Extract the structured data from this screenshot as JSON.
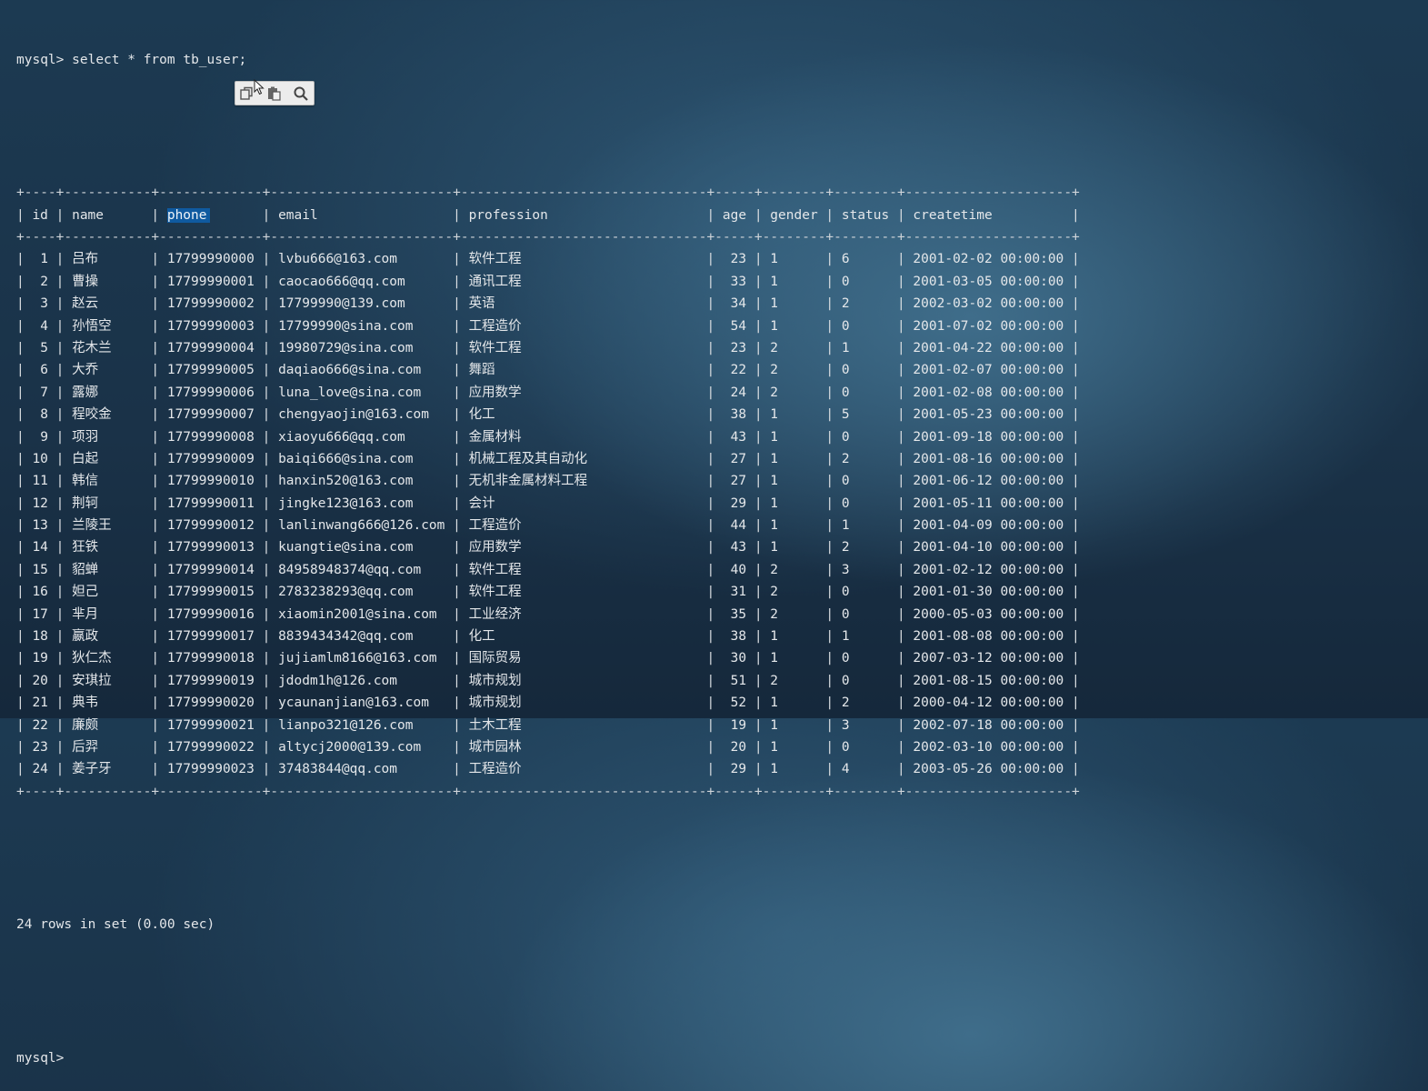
{
  "terminal": {
    "prompt": "mysql>",
    "command": "select * from tb_user;",
    "footer": "24 rows in set (0.00 sec)",
    "final_prompt": "mysql>"
  },
  "table": {
    "columns": [
      "id",
      "name",
      "phone",
      "email",
      "profession",
      "age",
      "gender",
      "status",
      "createtime"
    ],
    "highlighted_column": "phone",
    "rows": [
      [
        "1",
        "吕布",
        "17799990000",
        "lvbu666@163.com",
        "软件工程",
        "23",
        "1",
        "6",
        "2001-02-02 00:00:00"
      ],
      [
        "2",
        "曹操",
        "17799990001",
        "caocao666@qq.com",
        "通讯工程",
        "33",
        "1",
        "0",
        "2001-03-05 00:00:00"
      ],
      [
        "3",
        "赵云",
        "17799990002",
        "17799990@139.com",
        "英语",
        "34",
        "1",
        "2",
        "2002-03-02 00:00:00"
      ],
      [
        "4",
        "孙悟空",
        "17799990003",
        "17799990@sina.com",
        "工程造价",
        "54",
        "1",
        "0",
        "2001-07-02 00:00:00"
      ],
      [
        "5",
        "花木兰",
        "17799990004",
        "19980729@sina.com",
        "软件工程",
        "23",
        "2",
        "1",
        "2001-04-22 00:00:00"
      ],
      [
        "6",
        "大乔",
        "17799990005",
        "daqiao666@sina.com",
        "舞蹈",
        "22",
        "2",
        "0",
        "2001-02-07 00:00:00"
      ],
      [
        "7",
        "露娜",
        "17799990006",
        "luna_love@sina.com",
        "应用数学",
        "24",
        "2",
        "0",
        "2001-02-08 00:00:00"
      ],
      [
        "8",
        "程咬金",
        "17799990007",
        "chengyaojin@163.com",
        "化工",
        "38",
        "1",
        "5",
        "2001-05-23 00:00:00"
      ],
      [
        "9",
        "项羽",
        "17799990008",
        "xiaoyu666@qq.com",
        "金属材料",
        "43",
        "1",
        "0",
        "2001-09-18 00:00:00"
      ],
      [
        "10",
        "白起",
        "17799990009",
        "baiqi666@sina.com",
        "机械工程及其自动化",
        "27",
        "1",
        "2",
        "2001-08-16 00:00:00"
      ],
      [
        "11",
        "韩信",
        "17799990010",
        "hanxin520@163.com",
        "无机非金属材料工程",
        "27",
        "1",
        "0",
        "2001-06-12 00:00:00"
      ],
      [
        "12",
        "荆轲",
        "17799990011",
        "jingke123@163.com",
        "会计",
        "29",
        "1",
        "0",
        "2001-05-11 00:00:00"
      ],
      [
        "13",
        "兰陵王",
        "17799990012",
        "lanlinwang666@126.com",
        "工程造价",
        "44",
        "1",
        "1",
        "2001-04-09 00:00:00"
      ],
      [
        "14",
        "狂铁",
        "17799990013",
        "kuangtie@sina.com",
        "应用数学",
        "43",
        "1",
        "2",
        "2001-04-10 00:00:00"
      ],
      [
        "15",
        "貂蝉",
        "17799990014",
        "84958948374@qq.com",
        "软件工程",
        "40",
        "2",
        "3",
        "2001-02-12 00:00:00"
      ],
      [
        "16",
        "妲己",
        "17799990015",
        "2783238293@qq.com",
        "软件工程",
        "31",
        "2",
        "0",
        "2001-01-30 00:00:00"
      ],
      [
        "17",
        "芈月",
        "17799990016",
        "xiaomin2001@sina.com",
        "工业经济",
        "35",
        "2",
        "0",
        "2000-05-03 00:00:00"
      ],
      [
        "18",
        "嬴政",
        "17799990017",
        "8839434342@qq.com",
        "化工",
        "38",
        "1",
        "1",
        "2001-08-08 00:00:00"
      ],
      [
        "19",
        "狄仁杰",
        "17799990018",
        "jujiamlm8166@163.com",
        "国际贸易",
        "30",
        "1",
        "0",
        "2007-03-12 00:00:00"
      ],
      [
        "20",
        "安琪拉",
        "17799990019",
        "jdodm1h@126.com",
        "城市规划",
        "51",
        "2",
        "0",
        "2001-08-15 00:00:00"
      ],
      [
        "21",
        "典韦",
        "17799990020",
        "ycaunanjian@163.com",
        "城市规划",
        "52",
        "1",
        "2",
        "2000-04-12 00:00:00"
      ],
      [
        "22",
        "廉颇",
        "17799990021",
        "lianpo321@126.com",
        "土木工程",
        "19",
        "1",
        "3",
        "2002-07-18 00:00:00"
      ],
      [
        "23",
        "后羿",
        "17799990022",
        "altycj2000@139.com",
        "城市园林",
        "20",
        "1",
        "0",
        "2002-03-10 00:00:00"
      ],
      [
        "24",
        "姜子牙",
        "17799990023",
        "37483844@qq.com",
        "工程造价",
        "29",
        "1",
        "4",
        "2003-05-26 00:00:00"
      ]
    ]
  },
  "context_toolbar": {
    "icons": [
      "copy-icon",
      "paste-icon",
      "search-icon"
    ]
  }
}
